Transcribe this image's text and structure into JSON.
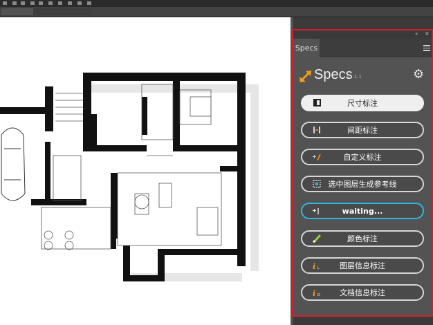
{
  "panel": {
    "tab_label": "Specs",
    "collapse_glyph": "«",
    "close_glyph": "×",
    "brand": "Specs",
    "version": "v1.1.1",
    "buttons": [
      {
        "label": "尺寸标注",
        "icon": "dimension-icon",
        "state": "active"
      },
      {
        "label": "间距标注",
        "icon": "spacing-icon",
        "state": "normal"
      },
      {
        "label": "自定义标注",
        "icon": "custom-annotation-icon",
        "state": "normal"
      },
      {
        "label": "选中图层生成参考线",
        "icon": "guide-icon",
        "state": "normal"
      },
      {
        "label": "waiting...",
        "icon": "waiting-icon",
        "state": "waiting"
      },
      {
        "label": "颜色标注",
        "icon": "color-picker-icon",
        "state": "normal"
      },
      {
        "label": "图层信息标注",
        "icon": "layer-info-icon",
        "state": "normal"
      },
      {
        "label": "文档信息标注",
        "icon": "document-info-icon",
        "state": "normal"
      }
    ]
  },
  "colors": {
    "highlight_border": "#d2202b",
    "waiting_accent": "#2fb7e6",
    "logo_orange": "#f39c1d",
    "panel_bg": "#535353"
  },
  "canvas": {
    "content": "architectural floor plan"
  }
}
